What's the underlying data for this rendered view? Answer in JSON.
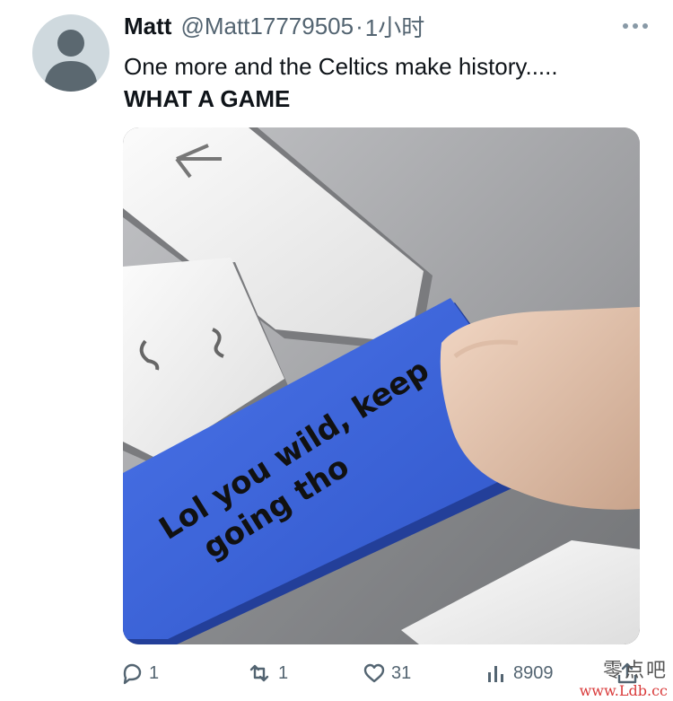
{
  "tweet": {
    "author": {
      "display_name": "Matt",
      "handle": "@Matt17779505",
      "separator": "·",
      "time": "1小时"
    },
    "text": {
      "line1": "One more and the Celtics make history.....",
      "line2": "WHAT A GAME"
    },
    "media": {
      "caption": "Lol you wild, keep going tho"
    },
    "actions": {
      "replies": "1",
      "retweets": "1",
      "likes": "31",
      "views": "8909"
    }
  },
  "watermark": {
    "text": "零点吧",
    "url": "www.Ldb.cc"
  },
  "colors": {
    "text_primary": "#0f1419",
    "text_secondary": "#536471",
    "key_blue": "#3d63d8",
    "watermark_red": "#d93a3a"
  }
}
